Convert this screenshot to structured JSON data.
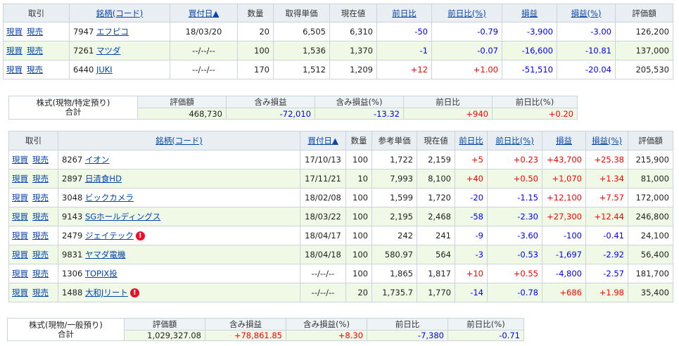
{
  "table1": {
    "headers": [
      "取引",
      "銘柄(コード)",
      "買付日▲",
      "数量",
      "取得単価",
      "現在値",
      "前日比",
      "前日比(%)",
      "損益",
      "損益(%)",
      "評価額"
    ],
    "rows": [
      {
        "buy": "現買",
        "sell": "現売",
        "code": "7947",
        "name": "エフピコ",
        "date": "18/03/20",
        "qty": "20",
        "price": "6,505",
        "current": "6,310",
        "change": "-50",
        "change_pct": "-0.79",
        "pl": "-3,900",
        "pl_pct": "-3.00",
        "value": "126,200"
      },
      {
        "buy": "現買",
        "sell": "現売",
        "code": "7261",
        "name": "マツダ",
        "date": "--/--/--",
        "qty": "100",
        "price": "1,536",
        "current": "1,370",
        "change": "-1",
        "change_pct": "-0.07",
        "pl": "-16,600",
        "pl_pct": "-10.81",
        "value": "137,000"
      },
      {
        "buy": "現買",
        "sell": "現売",
        "code": "6440",
        "name": "JUKI",
        "date": "--/--/--",
        "qty": "170",
        "price": "1,512",
        "current": "1,209",
        "change": "+12",
        "change_pct": "+1.00",
        "pl": "-51,510",
        "pl_pct": "-20.04",
        "value": "205,530"
      }
    ]
  },
  "summary1": {
    "label_line1": "株式(現物/特定預り)",
    "label_line2": "合計",
    "headers": [
      "評価額",
      "含み損益",
      "含み損益(%)",
      "前日比",
      "前日比(%)"
    ],
    "values": [
      "468,730",
      "-72,010",
      "-13.32",
      "+940",
      "+0.20"
    ]
  },
  "table2": {
    "headers": [
      "取引",
      "銘柄(コード)",
      "買付日▲",
      "数量",
      "参考単価",
      "現在値",
      "前日比",
      "前日比(%)",
      "損益",
      "損益(%)",
      "評価額"
    ],
    "rows": [
      {
        "buy": "現買",
        "sell": "現売",
        "code": "8267",
        "name": "イオン",
        "date": "17/10/13",
        "qty": "100",
        "price": "1,722",
        "current": "2,159",
        "change": "+5",
        "change_pct": "+0.23",
        "pl": "+43,700",
        "pl_pct": "+25.38",
        "value": "215,900",
        "warn": false
      },
      {
        "buy": "現買",
        "sell": "現売",
        "code": "2897",
        "name": "日清食HD",
        "date": "17/11/21",
        "qty": "10",
        "price": "7,993",
        "current": "8,100",
        "change": "+40",
        "change_pct": "+0.50",
        "pl": "+1,070",
        "pl_pct": "+1.34",
        "value": "81,000",
        "warn": false
      },
      {
        "buy": "現買",
        "sell": "現売",
        "code": "3048",
        "name": "ビックカメラ",
        "date": "18/02/08",
        "qty": "100",
        "price": "1,599",
        "current": "1,720",
        "change": "-20",
        "change_pct": "-1.15",
        "pl": "+12,100",
        "pl_pct": "+7.57",
        "value": "172,000",
        "warn": false
      },
      {
        "buy": "現買",
        "sell": "現売",
        "code": "9143",
        "name": "SGホールディングス",
        "date": "18/03/22",
        "qty": "100",
        "price": "2,195",
        "current": "2,468",
        "change": "-58",
        "change_pct": "-2.30",
        "pl": "+27,300",
        "pl_pct": "+12.44",
        "value": "246,800",
        "warn": false
      },
      {
        "buy": "現買",
        "sell": "現売",
        "code": "2479",
        "name": "ジェイテック",
        "date": "18/04/17",
        "qty": "100",
        "price": "242",
        "current": "241",
        "change": "-9",
        "change_pct": "-3.60",
        "pl": "-100",
        "pl_pct": "-0.41",
        "value": "24,100",
        "warn": true
      },
      {
        "buy": "現買",
        "sell": "現売",
        "code": "9831",
        "name": "ヤマダ電機",
        "date": "18/04/18",
        "qty": "100",
        "price": "580.97",
        "current": "564",
        "change": "-3",
        "change_pct": "-0.53",
        "pl": "-1,697",
        "pl_pct": "-2.92",
        "value": "56,400",
        "warn": false
      },
      {
        "buy": "現買",
        "sell": "現売",
        "code": "1306",
        "name": "TOPIX投",
        "date": "--/--/--",
        "qty": "100",
        "price": "1,865",
        "current": "1,817",
        "change": "+10",
        "change_pct": "+0.55",
        "pl": "-4,800",
        "pl_pct": "-2.57",
        "value": "181,700",
        "warn": false
      },
      {
        "buy": "現買",
        "sell": "現売",
        "code": "1488",
        "name": "大和Jリート",
        "date": "--/--/--",
        "qty": "20",
        "price": "1,735.7",
        "current": "1,770",
        "change": "-14",
        "change_pct": "-0.78",
        "pl": "+686",
        "pl_pct": "+1.98",
        "value": "35,400",
        "warn": true
      }
    ]
  },
  "summary2": {
    "label_line1": "株式(現物/一般預り)",
    "label_line2": "合計",
    "headers": [
      "評価額",
      "含み損益",
      "含み損益(%)",
      "前日比",
      "前日比(%)"
    ],
    "values": [
      "1,029,327.08",
      "+78,861.85",
      "+8.30",
      "-7,380",
      "-0.71"
    ]
  },
  "colors": {
    "positive": "#ff0000",
    "negative": "#0000ff",
    "row_alt": "#f0f8e6",
    "header_bg": "#e8eef2",
    "link": "#0645ad",
    "warn": "#e8102a"
  },
  "icons": {
    "warn": "alert-icon"
  }
}
